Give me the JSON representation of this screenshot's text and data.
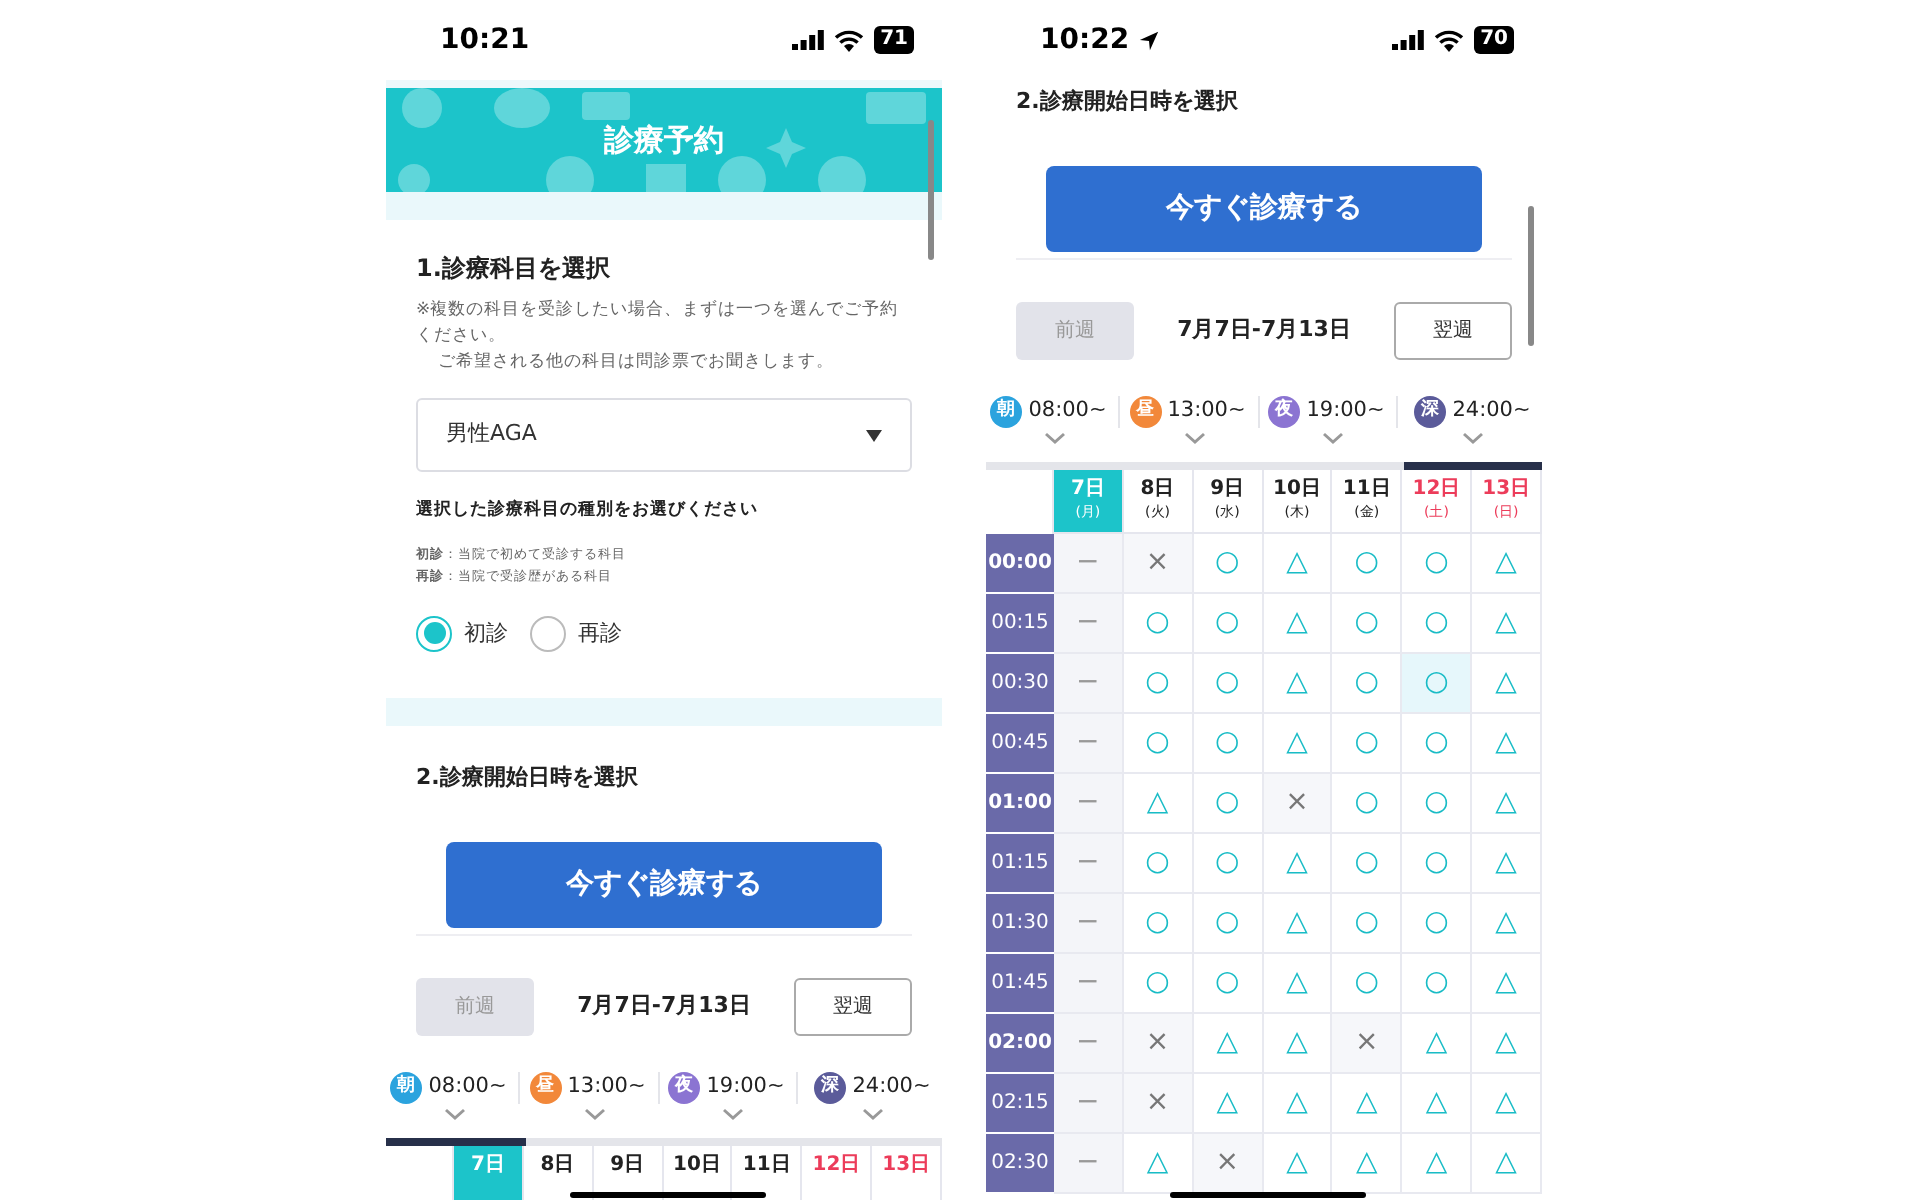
{
  "screens": [
    {
      "status_bar": {
        "time": "10:21",
        "battery": "71",
        "location": false
      },
      "header": {
        "title": "診療予約"
      },
      "section_1": {
        "title": "1.診療科目を選択",
        "notes": [
          "※複数の科目を受診したい場合、まずは一つを選んでご予約ください。",
          "ご希望される他の科目は問診票でお聞きします。"
        ],
        "select": {
          "value": "男性AGA"
        },
        "subheading": "選択した診療科目の種別をお選びください",
        "legend": [
          "**初診**：当院で初めて受診する科目",
          "**再診**：当院で受診歴がある科目"
        ],
        "radios": [
          {
            "label": "初診",
            "selected": true
          },
          {
            "label": "再診",
            "selected": false
          }
        ]
      },
      "section_2": {
        "title": "2.診療開始日時を選択",
        "button": "今すぐ診療する",
        "prev_week": {
          "label": "前週",
          "disabled": true
        },
        "week_range": "7月7日-7月13日",
        "next_week": {
          "label": "翌週",
          "disabled": false
        },
        "slot_tabs": [
          {
            "icon_char": "朝",
            "time": "08:00~",
            "color": "#2ba3de",
            "selected": true
          },
          {
            "icon_char": "昼",
            "time": "13:00~",
            "color": "#f2883a",
            "selected": false
          },
          {
            "icon_char": "夜",
            "time": "19:00~",
            "color": "#8b74d2",
            "selected": false
          },
          {
            "icon_char": "深",
            "time": "24:00~",
            "color": "#5b5b9a",
            "selected": false
          }
        ],
        "days": [
          {
            "day": "7日",
            "selected": true,
            "weekend": false
          },
          {
            "day": "8日",
            "selected": false,
            "weekend": false
          },
          {
            "day": "9日",
            "selected": false,
            "weekend": false
          },
          {
            "day": "10日",
            "selected": false,
            "weekend": false
          },
          {
            "day": "11日",
            "selected": false,
            "weekend": false
          },
          {
            "day": "12日",
            "selected": false,
            "weekend": true
          },
          {
            "day": "13日",
            "selected": false,
            "weekend": true
          }
        ]
      }
    },
    {
      "status_bar": {
        "time": "10:22",
        "battery": "70",
        "location": true
      },
      "section_2": {
        "title": "2.診療開始日時を選択",
        "button": "今すぐ診療する",
        "prev_week": {
          "label": "前週",
          "disabled": true
        },
        "week_range": "7月7日-7月13日",
        "next_week": {
          "label": "翌週",
          "disabled": false
        },
        "slot_tabs": [
          {
            "icon_char": "朝",
            "time": "08:00~",
            "color": "#2ba3de",
            "selected": false
          },
          {
            "icon_char": "昼",
            "time": "13:00~",
            "color": "#f2883a",
            "selected": false
          },
          {
            "icon_char": "夜",
            "time": "19:00~",
            "color": "#8b74d2",
            "selected": false
          },
          {
            "icon_char": "深",
            "time": "24:00~",
            "color": "#5b5b9a",
            "selected": true
          }
        ],
        "days": [
          {
            "day": "7日",
            "weekday": "(月)",
            "selected": true,
            "weekend": false
          },
          {
            "day": "8日",
            "weekday": "(火)",
            "selected": false,
            "weekend": false
          },
          {
            "day": "9日",
            "weekday": "(水)",
            "selected": false,
            "weekend": false
          },
          {
            "day": "10日",
            "weekday": "(木)",
            "selected": false,
            "weekend": false
          },
          {
            "day": "11日",
            "weekday": "(金)",
            "selected": false,
            "weekend": false
          },
          {
            "day": "12日",
            "weekday": "(土)",
            "selected": false,
            "weekend": true
          },
          {
            "day": "13日",
            "weekday": "(日)",
            "selected": false,
            "weekend": true
          }
        ],
        "rows": [
          {
            "time": "00:00",
            "hour": true,
            "cells": [
              {
                "mark": "−",
                "kind": "none",
                "selected": false
              },
              {
                "mark": "×",
                "kind": "full",
                "selected": false
              },
              {
                "mark": "○",
                "kind": "open",
                "selected": false
              },
              {
                "mark": "△",
                "kind": "few",
                "selected": false
              },
              {
                "mark": "○",
                "kind": "open",
                "selected": false
              },
              {
                "mark": "○",
                "kind": "open",
                "selected": false
              },
              {
                "mark": "△",
                "kind": "few",
                "selected": false
              }
            ]
          },
          {
            "time": "00:15",
            "hour": false,
            "cells": [
              {
                "mark": "−",
                "kind": "none",
                "selected": false
              },
              {
                "mark": "○",
                "kind": "open",
                "selected": false
              },
              {
                "mark": "○",
                "kind": "open",
                "selected": false
              },
              {
                "mark": "△",
                "kind": "few",
                "selected": false
              },
              {
                "mark": "○",
                "kind": "open",
                "selected": false
              },
              {
                "mark": "○",
                "kind": "open",
                "selected": false
              },
              {
                "mark": "△",
                "kind": "few",
                "selected": false
              }
            ]
          },
          {
            "time": "00:30",
            "hour": false,
            "cells": [
              {
                "mark": "−",
                "kind": "none",
                "selected": false
              },
              {
                "mark": "○",
                "kind": "open",
                "selected": false
              },
              {
                "mark": "○",
                "kind": "open",
                "selected": false
              },
              {
                "mark": "△",
                "kind": "few",
                "selected": false
              },
              {
                "mark": "○",
                "kind": "open",
                "selected": false
              },
              {
                "mark": "○",
                "kind": "open",
                "selected": true
              },
              {
                "mark": "△",
                "kind": "few",
                "selected": false
              }
            ]
          },
          {
            "time": "00:45",
            "hour": false,
            "cells": [
              {
                "mark": "−",
                "kind": "none",
                "selected": false
              },
              {
                "mark": "○",
                "kind": "open",
                "selected": false
              },
              {
                "mark": "○",
                "kind": "open",
                "selected": false
              },
              {
                "mark": "△",
                "kind": "few",
                "selected": false
              },
              {
                "mark": "○",
                "kind": "open",
                "selected": false
              },
              {
                "mark": "○",
                "kind": "open",
                "selected": false
              },
              {
                "mark": "△",
                "kind": "few",
                "selected": false
              }
            ]
          },
          {
            "time": "01:00",
            "hour": true,
            "cells": [
              {
                "mark": "−",
                "kind": "none",
                "selected": false
              },
              {
                "mark": "△",
                "kind": "few",
                "selected": false
              },
              {
                "mark": "○",
                "kind": "open",
                "selected": false
              },
              {
                "mark": "×",
                "kind": "full",
                "selected": false
              },
              {
                "mark": "○",
                "kind": "open",
                "selected": false
              },
              {
                "mark": "○",
                "kind": "open",
                "selected": false
              },
              {
                "mark": "△",
                "kind": "few",
                "selected": false
              }
            ]
          },
          {
            "time": "01:15",
            "hour": false,
            "cells": [
              {
                "mark": "−",
                "kind": "none",
                "selected": false
              },
              {
                "mark": "○",
                "kind": "open",
                "selected": false
              },
              {
                "mark": "○",
                "kind": "open",
                "selected": false
              },
              {
                "mark": "△",
                "kind": "few",
                "selected": false
              },
              {
                "mark": "○",
                "kind": "open",
                "selected": false
              },
              {
                "mark": "○",
                "kind": "open",
                "selected": false
              },
              {
                "mark": "△",
                "kind": "few",
                "selected": false
              }
            ]
          },
          {
            "time": "01:30",
            "hour": false,
            "cells": [
              {
                "mark": "−",
                "kind": "none",
                "selected": false
              },
              {
                "mark": "○",
                "kind": "open",
                "selected": false
              },
              {
                "mark": "○",
                "kind": "open",
                "selected": false
              },
              {
                "mark": "△",
                "kind": "few",
                "selected": false
              },
              {
                "mark": "○",
                "kind": "open",
                "selected": false
              },
              {
                "mark": "○",
                "kind": "open",
                "selected": false
              },
              {
                "mark": "△",
                "kind": "few",
                "selected": false
              }
            ]
          },
          {
            "time": "01:45",
            "hour": false,
            "cells": [
              {
                "mark": "−",
                "kind": "none",
                "selected": false
              },
              {
                "mark": "○",
                "kind": "open",
                "selected": false
              },
              {
                "mark": "○",
                "kind": "open",
                "selected": false
              },
              {
                "mark": "△",
                "kind": "few",
                "selected": false
              },
              {
                "mark": "○",
                "kind": "open",
                "selected": false
              },
              {
                "mark": "○",
                "kind": "open",
                "selected": false
              },
              {
                "mark": "△",
                "kind": "few",
                "selected": false
              }
            ]
          },
          {
            "time": "02:00",
            "hour": true,
            "cells": [
              {
                "mark": "−",
                "kind": "none",
                "selected": false
              },
              {
                "mark": "×",
                "kind": "full",
                "selected": false
              },
              {
                "mark": "△",
                "kind": "few",
                "selected": false
              },
              {
                "mark": "△",
                "kind": "few",
                "selected": false
              },
              {
                "mark": "×",
                "kind": "full",
                "selected": false
              },
              {
                "mark": "△",
                "kind": "few",
                "selected": false
              },
              {
                "mark": "△",
                "kind": "few",
                "selected": false
              }
            ]
          },
          {
            "time": "02:15",
            "hour": false,
            "cells": [
              {
                "mark": "−",
                "kind": "none",
                "selected": false
              },
              {
                "mark": "×",
                "kind": "full",
                "selected": false
              },
              {
                "mark": "△",
                "kind": "few",
                "selected": false
              },
              {
                "mark": "△",
                "kind": "few",
                "selected": false
              },
              {
                "mark": "△",
                "kind": "few",
                "selected": false
              },
              {
                "mark": "△",
                "kind": "few",
                "selected": false
              },
              {
                "mark": "△",
                "kind": "few",
                "selected": false
              }
            ]
          },
          {
            "time": "02:30",
            "hour": false,
            "cells": [
              {
                "mark": "−",
                "kind": "none",
                "selected": false
              },
              {
                "mark": "△",
                "kind": "few",
                "selected": false
              },
              {
                "mark": "×",
                "kind": "full",
                "selected": false
              },
              {
                "mark": "△",
                "kind": "few",
                "selected": false
              },
              {
                "mark": "△",
                "kind": "few",
                "selected": false
              },
              {
                "mark": "△",
                "kind": "few",
                "selected": false
              },
              {
                "mark": "△",
                "kind": "few",
                "selected": false
              }
            ]
          }
        ]
      }
    }
  ]
}
